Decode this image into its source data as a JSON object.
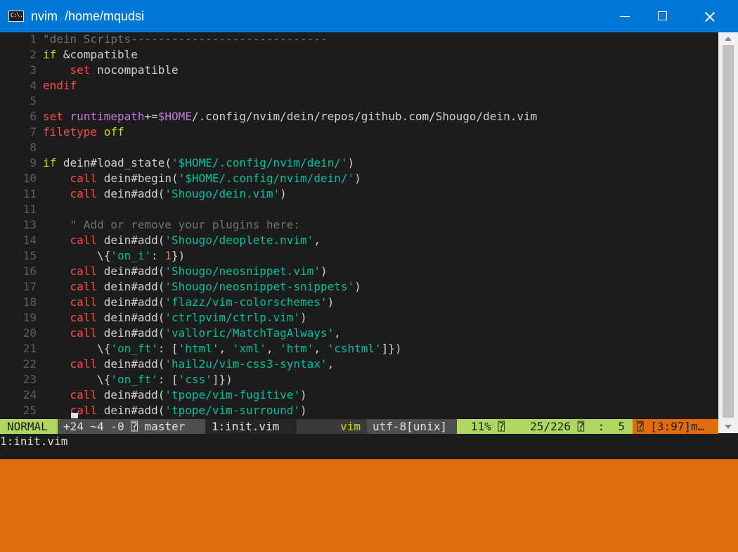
{
  "window": {
    "title": "nvim  /home/mqudsi",
    "icon_label": "C:\\."
  },
  "editor": {
    "lines": [
      {
        "n": "1",
        "t": [
          {
            "c": "cm",
            "s": "\"dein Scripts-----------------------------"
          }
        ]
      },
      {
        "n": "2",
        "t": [
          {
            "c": "kw",
            "s": "if"
          },
          {
            "c": "",
            "s": " &compatible"
          }
        ]
      },
      {
        "n": "3",
        "t": [
          {
            "c": "",
            "s": "    "
          },
          {
            "c": "st",
            "s": "set"
          },
          {
            "c": "",
            "s": " nocompatible"
          }
        ]
      },
      {
        "n": "4",
        "t": [
          {
            "c": "st",
            "s": "endif"
          }
        ]
      },
      {
        "n": "5",
        "t": []
      },
      {
        "n": "6",
        "t": [
          {
            "c": "st",
            "s": "set"
          },
          {
            "c": "",
            "s": " "
          },
          {
            "c": "vr",
            "s": "runtimepath"
          },
          {
            "c": "",
            "s": "+="
          },
          {
            "c": "vr",
            "s": "$HOME"
          },
          {
            "c": "",
            "s": "/.config/nvim/dein/repos/github.com/Shougo/dein.vim"
          }
        ]
      },
      {
        "n": "7",
        "t": [
          {
            "c": "st",
            "s": "filetype"
          },
          {
            "c": "",
            "s": " "
          },
          {
            "c": "kw",
            "s": "off"
          }
        ]
      },
      {
        "n": "8",
        "t": []
      },
      {
        "n": "9",
        "t": [
          {
            "c": "kw",
            "s": "if"
          },
          {
            "c": "",
            "s": " dein#load_state("
          },
          {
            "c": "sr",
            "s": "'$HOME/.config/nvim/dein/'"
          },
          {
            "c": "",
            "s": ")"
          }
        ]
      },
      {
        "n": "10",
        "t": [
          {
            "c": "",
            "s": "    "
          },
          {
            "c": "st",
            "s": "call"
          },
          {
            "c": "",
            "s": " dein#begin("
          },
          {
            "c": "sr",
            "s": "'$HOME/.config/nvim/dein/'"
          },
          {
            "c": "",
            "s": ")"
          }
        ]
      },
      {
        "n": "11",
        "t": [
          {
            "c": "",
            "s": "    "
          },
          {
            "c": "st",
            "s": "call"
          },
          {
            "c": "",
            "s": " dein#add("
          },
          {
            "c": "sr",
            "s": "'Shougo/dein.vim'"
          },
          {
            "c": "",
            "s": ")"
          }
        ]
      },
      {
        "n": "11",
        "t": []
      },
      {
        "n": "13",
        "t": [
          {
            "c": "",
            "s": "    "
          },
          {
            "c": "cm",
            "s": "\" Add or remove your plugins here:"
          }
        ]
      },
      {
        "n": "14",
        "t": [
          {
            "c": "",
            "s": "    "
          },
          {
            "c": "st",
            "s": "call"
          },
          {
            "c": "",
            "s": " dein#add("
          },
          {
            "c": "sr",
            "s": "'Shougo/deoplete.nvim'"
          },
          {
            "c": "",
            "s": ","
          }
        ]
      },
      {
        "n": "15",
        "t": [
          {
            "c": "",
            "s": "        \\{"
          },
          {
            "c": "sr",
            "s": "'on_i'"
          },
          {
            "c": "",
            "s": ": "
          },
          {
            "c": "nm",
            "s": "1"
          },
          {
            "c": "",
            "s": "})"
          }
        ]
      },
      {
        "n": "16",
        "t": [
          {
            "c": "",
            "s": "    "
          },
          {
            "c": "st",
            "s": "call"
          },
          {
            "c": "",
            "s": " dein#add("
          },
          {
            "c": "sr",
            "s": "'Shougo/neosnippet.vim'"
          },
          {
            "c": "",
            "s": ")"
          }
        ]
      },
      {
        "n": "17",
        "t": [
          {
            "c": "",
            "s": "    "
          },
          {
            "c": "st",
            "s": "call"
          },
          {
            "c": "",
            "s": " dein#add("
          },
          {
            "c": "sr",
            "s": "'Shougo/neosnippet-snippets'"
          },
          {
            "c": "",
            "s": ")"
          }
        ]
      },
      {
        "n": "18",
        "t": [
          {
            "c": "",
            "s": "    "
          },
          {
            "c": "st",
            "s": "call"
          },
          {
            "c": "",
            "s": " dein#add("
          },
          {
            "c": "sr",
            "s": "'flazz/vim-colorschemes'"
          },
          {
            "c": "",
            "s": ")"
          }
        ]
      },
      {
        "n": "19",
        "t": [
          {
            "c": "",
            "s": "    "
          },
          {
            "c": "st",
            "s": "call"
          },
          {
            "c": "",
            "s": " dein#add("
          },
          {
            "c": "sr",
            "s": "'ctrlpvim/ctrlp.vim'"
          },
          {
            "c": "",
            "s": ")"
          }
        ]
      },
      {
        "n": "20",
        "t": [
          {
            "c": "",
            "s": "    "
          },
          {
            "c": "st",
            "s": "call"
          },
          {
            "c": "",
            "s": " dein#add("
          },
          {
            "c": "sr",
            "s": "'valloric/MatchTagAlways'"
          },
          {
            "c": "",
            "s": ","
          }
        ]
      },
      {
        "n": "21",
        "t": [
          {
            "c": "",
            "s": "        \\{"
          },
          {
            "c": "sr",
            "s": "'on_ft'"
          },
          {
            "c": "",
            "s": ": ["
          },
          {
            "c": "sr",
            "s": "'html'"
          },
          {
            "c": "",
            "s": ", "
          },
          {
            "c": "sr",
            "s": "'xml'"
          },
          {
            "c": "",
            "s": ", "
          },
          {
            "c": "sr",
            "s": "'htm'"
          },
          {
            "c": "",
            "s": ", "
          },
          {
            "c": "sr",
            "s": "'cshtml'"
          },
          {
            "c": "",
            "s": "]})"
          }
        ]
      },
      {
        "n": "22",
        "t": [
          {
            "c": "",
            "s": "    "
          },
          {
            "c": "st",
            "s": "call"
          },
          {
            "c": "",
            "s": " dein#add("
          },
          {
            "c": "sr",
            "s": "'hail2u/vim-css3-syntax'"
          },
          {
            "c": "",
            "s": ","
          }
        ]
      },
      {
        "n": "23",
        "t": [
          {
            "c": "",
            "s": "        \\{"
          },
          {
            "c": "sr",
            "s": "'on_ft'"
          },
          {
            "c": "",
            "s": ": ["
          },
          {
            "c": "sr",
            "s": "'css'"
          },
          {
            "c": "",
            "s": "]})"
          }
        ]
      },
      {
        "n": "24",
        "t": [
          {
            "c": "",
            "s": "    "
          },
          {
            "c": "st",
            "s": "call"
          },
          {
            "c": "",
            "s": " dein#add("
          },
          {
            "c": "sr",
            "s": "'tpope/vim-fugitive'"
          },
          {
            "c": "",
            "s": ")"
          }
        ]
      },
      {
        "n": "25",
        "t": [
          {
            "c": "",
            "s": "    "
          },
          {
            "c": "st",
            "s": "call"
          },
          {
            "c": "",
            "s": " dein#add("
          },
          {
            "c": "sr",
            "s": "'tpope/vim-surround'"
          },
          {
            "c": "",
            "s": ")"
          }
        ]
      }
    ]
  },
  "statusline": {
    "mode": "NORMAL",
    "git": "+24 ~4 -0 ⍰ master",
    "buffer": "1:init.vim",
    "filetype": "vim",
    "encoding": "utf-8[unix]",
    "percent": "11% ⍰",
    "position": "25/226 ⍰  :  5",
    "warning": "⍰ [3:97]m…"
  },
  "cmdline": {
    "text": "1:init.vim"
  },
  "colors": {
    "titlebar": "#0078d7",
    "mode_bg": "#afd75f",
    "warning_bg": "#e06c0a",
    "keyword": "#d7d700",
    "statement": "#ff4b4b",
    "string": "#00c0a0",
    "variable": "#c678dd"
  }
}
